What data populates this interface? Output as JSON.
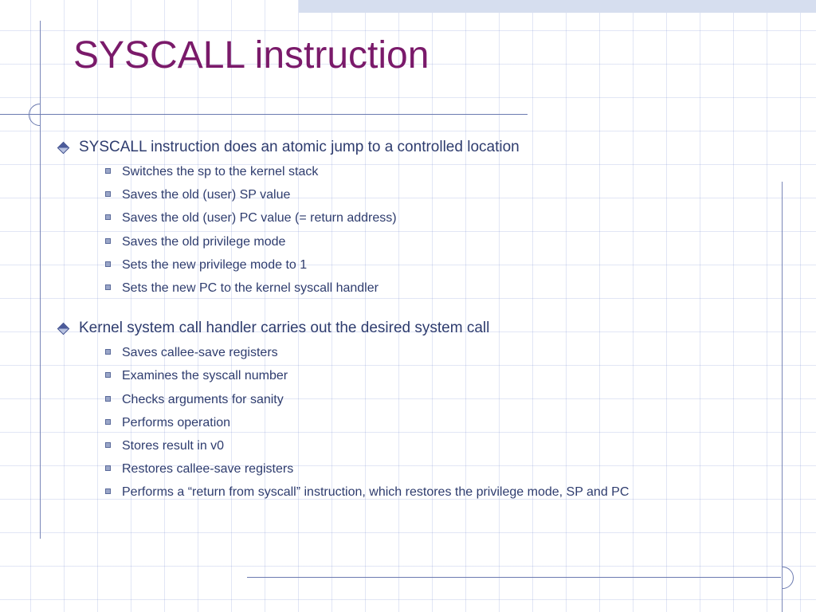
{
  "title": "SYSCALL instruction",
  "sections": [
    {
      "heading": "SYSCALL instruction does an atomic jump to a controlled location",
      "items": [
        "Switches the sp to the kernel stack",
        "Saves the old (user) SP value",
        "Saves the old (user) PC value (= return address)",
        "Saves the old privilege mode",
        "Sets the new privilege mode to 1",
        "Sets the new PC to the kernel syscall handler"
      ]
    },
    {
      "heading": "Kernel system call handler carries out the desired system call",
      "items": [
        "Saves callee-save registers",
        "Examines the syscall number",
        "Checks arguments for sanity",
        "Performs operation",
        "Stores result in v0",
        "Restores callee-save registers",
        "Performs a “return from syscall” instruction, which restores the privilege mode, SP and PC"
      ]
    }
  ]
}
